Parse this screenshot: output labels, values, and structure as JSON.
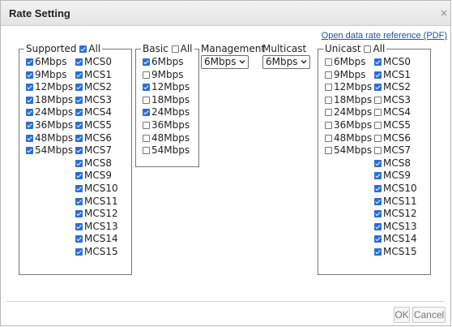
{
  "dialog": {
    "title": "Rate Setting",
    "close_symbol": "×",
    "pdf_link": "Open data rate reference (PDF)",
    "ok_label": "OK",
    "cancel_label": "Cancel"
  },
  "supported": {
    "title": "Supported",
    "all_label": "All",
    "all_checked": true,
    "rates": [
      {
        "label": "6Mbps",
        "checked": true
      },
      {
        "label": "9Mbps",
        "checked": true
      },
      {
        "label": "12Mbps",
        "checked": true
      },
      {
        "label": "18Mbps",
        "checked": true
      },
      {
        "label": "24Mbps",
        "checked": true
      },
      {
        "label": "36Mbps",
        "checked": true
      },
      {
        "label": "48Mbps",
        "checked": true
      },
      {
        "label": "54Mbps",
        "checked": true
      }
    ],
    "mcs": [
      {
        "label": "MCS0",
        "checked": true
      },
      {
        "label": "MCS1",
        "checked": true
      },
      {
        "label": "MCS2",
        "checked": true
      },
      {
        "label": "MCS3",
        "checked": true
      },
      {
        "label": "MCS4",
        "checked": true
      },
      {
        "label": "MCS5",
        "checked": true
      },
      {
        "label": "MCS6",
        "checked": true
      },
      {
        "label": "MCS7",
        "checked": true
      },
      {
        "label": "MCS8",
        "checked": true
      },
      {
        "label": "MCS9",
        "checked": true
      },
      {
        "label": "MCS10",
        "checked": true
      },
      {
        "label": "MCS11",
        "checked": true
      },
      {
        "label": "MCS12",
        "checked": true
      },
      {
        "label": "MCS13",
        "checked": true
      },
      {
        "label": "MCS14",
        "checked": true
      },
      {
        "label": "MCS15",
        "checked": true
      }
    ]
  },
  "basic": {
    "title": "Basic",
    "all_label": "All",
    "all_checked": false,
    "rates": [
      {
        "label": "6Mbps",
        "checked": true
      },
      {
        "label": "9Mbps",
        "checked": false
      },
      {
        "label": "12Mbps",
        "checked": true
      },
      {
        "label": "18Mbps",
        "checked": false
      },
      {
        "label": "24Mbps",
        "checked": true
      },
      {
        "label": "36Mbps",
        "checked": false
      },
      {
        "label": "48Mbps",
        "checked": false
      },
      {
        "label": "54Mbps",
        "checked": false
      }
    ]
  },
  "management": {
    "label": "Management",
    "value": "6Mbps"
  },
  "multicast": {
    "label": "Multicast",
    "value": "6Mbps"
  },
  "unicast": {
    "title": "Unicast",
    "all_label": "All",
    "all_checked": false,
    "rates": [
      {
        "label": "6Mbps",
        "checked": false
      },
      {
        "label": "9Mbps",
        "checked": false
      },
      {
        "label": "12Mbps",
        "checked": false
      },
      {
        "label": "18Mbps",
        "checked": false
      },
      {
        "label": "24Mbps",
        "checked": false
      },
      {
        "label": "36Mbps",
        "checked": false
      },
      {
        "label": "48Mbps",
        "checked": false
      },
      {
        "label": "54Mbps",
        "checked": false
      }
    ],
    "mcs": [
      {
        "label": "MCS0",
        "checked": true
      },
      {
        "label": "MCS1",
        "checked": true
      },
      {
        "label": "MCS2",
        "checked": true
      },
      {
        "label": "MCS3",
        "checked": false
      },
      {
        "label": "MCS4",
        "checked": false
      },
      {
        "label": "MCS5",
        "checked": false
      },
      {
        "label": "MCS6",
        "checked": false
      },
      {
        "label": "MCS7",
        "checked": false
      },
      {
        "label": "MCS8",
        "checked": true
      },
      {
        "label": "MCS9",
        "checked": true
      },
      {
        "label": "MCS10",
        "checked": true
      },
      {
        "label": "MCS11",
        "checked": true
      },
      {
        "label": "MCS12",
        "checked": true
      },
      {
        "label": "MCS13",
        "checked": true
      },
      {
        "label": "MCS14",
        "checked": true
      },
      {
        "label": "MCS15",
        "checked": true
      }
    ]
  },
  "colors": {
    "checkbox_checked": "#2a6fd6",
    "link": "#1a56a0"
  }
}
